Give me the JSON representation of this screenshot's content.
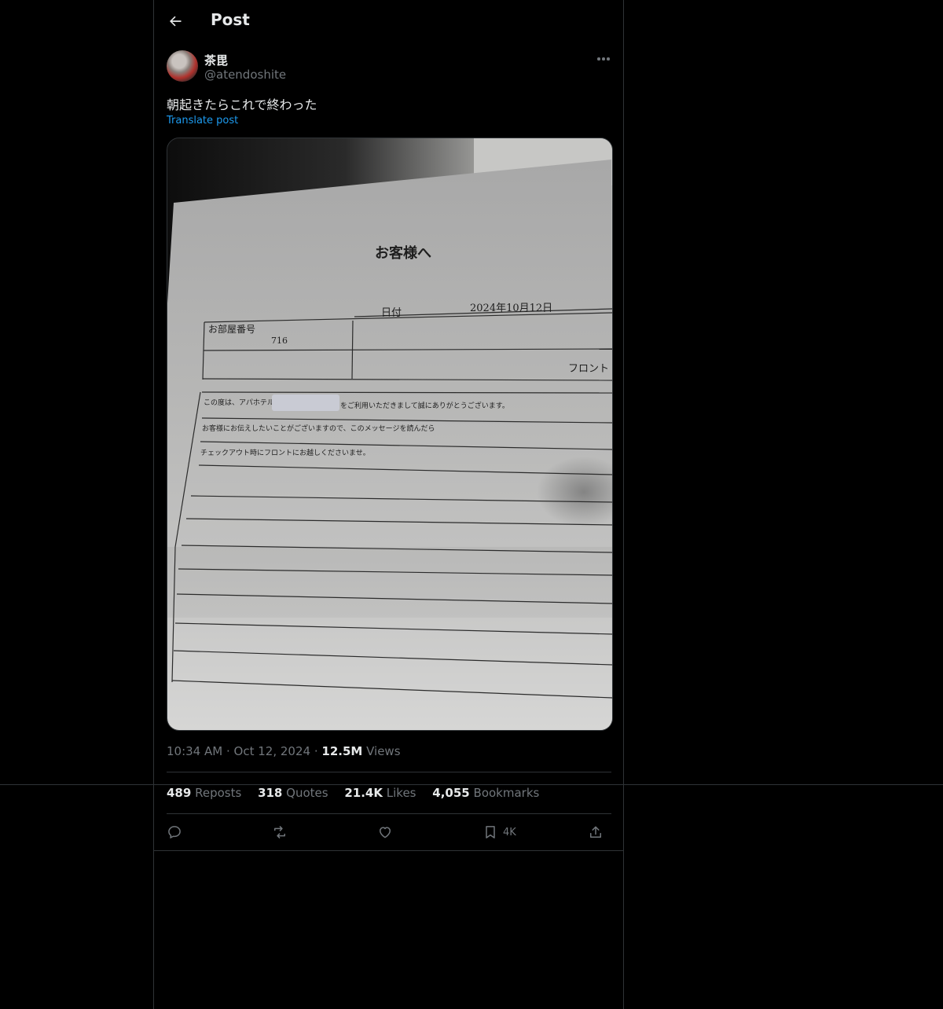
{
  "header": {
    "title": "Post"
  },
  "author": {
    "name": "茶毘",
    "handle": "@atendoshite"
  },
  "post": {
    "text": "朝起きたらこれで終わった",
    "translate_label": "Translate post",
    "image": {
      "heading": "お客様へ",
      "date_label": "日付",
      "date_value": "2024年10月12日",
      "room_label": "お部屋番号",
      "room_value": "716",
      "front_label": "フロント",
      "line1_a": "この度は、アパホテル",
      "line1_b": "をご利用いただきまして誠にありがとうございます。",
      "line2": "お客様にお伝えしたいことがございますので、このメッセージを読んだら",
      "line3": "チェックアウト時にフロントにお越しくださいませ。"
    }
  },
  "meta": {
    "time": "10:34 AM",
    "dot": "·",
    "date": "Oct 12, 2024",
    "views_count": "12.5M",
    "views_label": "Views"
  },
  "stats": {
    "reposts_count": "489",
    "reposts_label": "Reposts",
    "quotes_count": "318",
    "quotes_label": "Quotes",
    "likes_count": "21.4K",
    "likes_label": "Likes",
    "bookmarks_count": "4,055",
    "bookmarks_label": "Bookmarks"
  },
  "actions": {
    "bookmark_count": "4K"
  },
  "icons": [
    "back-arrow-icon",
    "more-icon",
    "reply-icon",
    "repost-icon",
    "like-icon",
    "bookmark-icon",
    "share-icon"
  ],
  "colors": {
    "background": "#000000",
    "text": "#e7e9ea",
    "muted": "#71767b",
    "link": "#1d9bf0",
    "border": "#2f3336"
  }
}
